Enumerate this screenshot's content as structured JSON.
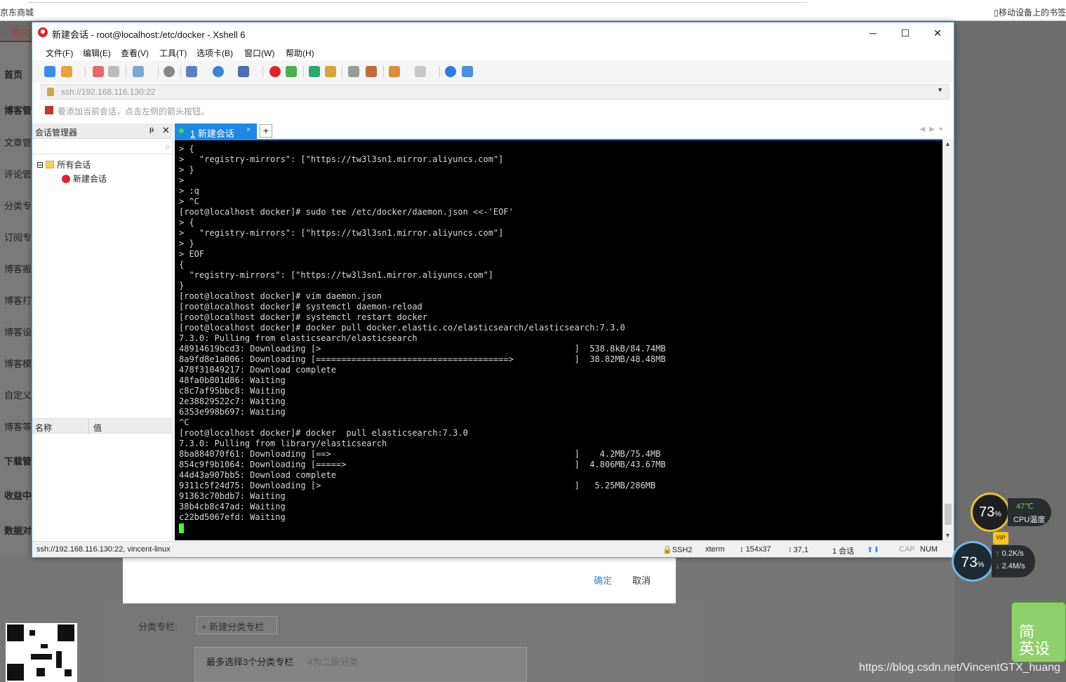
{
  "browser": {
    "left_text": "京东商城",
    "right_text": "移动设备上的书签"
  },
  "left_nav": {
    "top": "富文",
    "items": [
      "首页",
      "博客管",
      "文章管",
      "评论管",
      "分类专",
      "订阅专",
      "博客搬",
      "博客打",
      "博客设",
      "博客模",
      "自定义",
      "博客等",
      "下载管",
      "收益中",
      "数据对"
    ]
  },
  "window": {
    "title": "新建会话 - root@localhost:/etc/docker - Xshell 6",
    "controls": [
      "─",
      "☐",
      "✕"
    ],
    "menu": [
      "文件(F)",
      "编辑(E)",
      "查看(V)",
      "工具(T)",
      "选项卡(B)",
      "窗口(W)",
      "帮助(H)"
    ],
    "address": "ssh://192.168.116.130:22",
    "hint": "要添加当前会话，点击左侧的箭头按钮。"
  },
  "session_manager": {
    "title": "会话管理器",
    "pin": "ᵽ",
    "close": "✕",
    "root_folder": "所有会话",
    "sessions": [
      "新建会话"
    ],
    "props_col1": "名称",
    "props_col2": "值"
  },
  "tab": {
    "number": "1",
    "label": "新建会话",
    "close": "×",
    "add": "+"
  },
  "terminal": {
    "lines": [
      "> {",
      ">   \"registry-mirrors\": [\"https://tw3l3sn1.mirror.aliyuncs.com\"]",
      "> }",
      ">",
      "> :q",
      "> ^C",
      "[root@localhost docker]# sudo tee /etc/docker/daemon.json <<-'EOF'",
      "> {",
      ">   \"registry-mirrors\": [\"https://tw3l3sn1.mirror.aliyuncs.com\"]",
      "> }",
      "> EOF",
      "{",
      "  \"registry-mirrors\": [\"https://tw3l3sn1.mirror.aliyuncs.com\"]",
      "}",
      "[root@localhost docker]# vim daemon.json",
      "[root@localhost docker]# systemctl daemon-reload",
      "[root@localhost docker]# systemctl restart docker",
      "[root@localhost docker]# docker pull docker.elastic.co/elasticsearch/elasticsearch:7.3.0",
      "7.3.0: Pulling from elasticsearch/elasticsearch",
      "48914619bcd3: Downloading [>                                                  ]  538.8kB/84.74MB",
      "8a9fd8e1a006: Downloading [======================================>            ]  38.82MB/48.48MB",
      "478f31049217: Download complete",
      "48fa0b801d86: Waiting",
      "c8c7af95bbc8: Waiting",
      "2e38829522c7: Waiting",
      "6353e998b697: Waiting",
      "^C",
      "[root@localhost docker]# docker  pull elasticsearch:7.3.0",
      "7.3.0: Pulling from library/elasticsearch",
      "8ba884070f61: Downloading [==>                                                ]    4.2MB/75.4MB",
      "854c9f9b1064: Downloading [=====>                                             ]  4.806MB/43.67MB",
      "44d43a907bb5: Download complete",
      "9311c5f24d75: Download‌ing [>                                                  ]   5.25MB/286MB",
      "91363c70bdb7: Waiting",
      "38b4cb8c47ad: Waiting",
      "c22bd5067efd: Waiting"
    ]
  },
  "statusbar": {
    "left": "ssh://192.168.116.130:22, vincent-linux",
    "proto": "SSH2",
    "term": "xterm",
    "size": "154x37",
    "pos": "37,1",
    "sessions": "1 会话",
    "cap": "CAP",
    "num": "NUM"
  },
  "dialog": {
    "ok": "确定",
    "cancel": "取消"
  },
  "page": {
    "category_label": "分类专栏:",
    "new_category": "+ 新建分类专栏",
    "category_hint_title": "最多选择3个分类专栏",
    "category_hint_sub": "#为二级分类"
  },
  "widgets": {
    "cpu_percent": "73",
    "percent_sign": "%",
    "cpu_temp": "47℃",
    "cpu_label": "CPU温度",
    "mem_percent": "73",
    "up_speed": "0.2",
    "up_unit": "K/s",
    "down_speed": "2.4",
    "down_unit": "M/s",
    "vip": "VIP",
    "ime_line1": "简",
    "ime_line2": "英设"
  },
  "watermark": "https://blog.csdn.net/VincentGTX_huang",
  "colors": {
    "accent": "#1e88e5",
    "cursor": "#3dff3d",
    "terminal_bg": "#000000"
  }
}
